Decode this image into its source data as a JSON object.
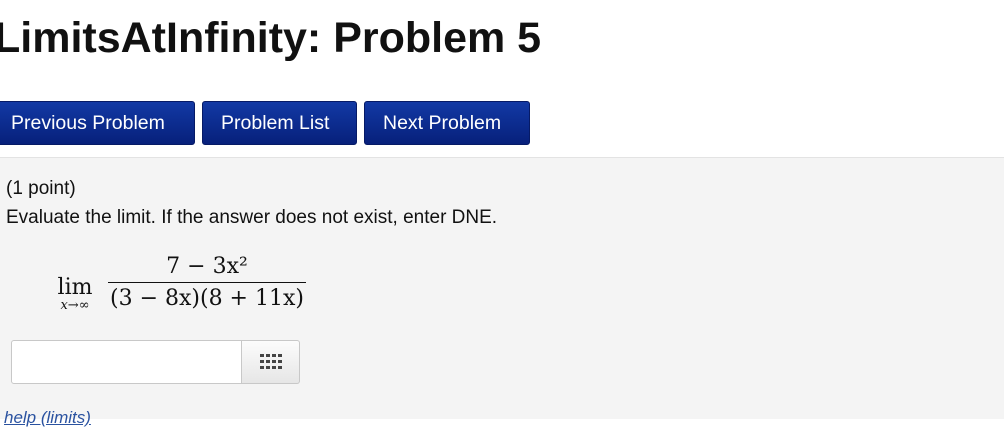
{
  "page": {
    "title": "LimitsAtInfinity: Problem 5"
  },
  "nav": {
    "previous_label": "Previous Problem",
    "list_label": "Problem List",
    "next_label": "Next Problem"
  },
  "problem": {
    "points": "(1 point)",
    "prompt": "Evaluate the limit. If the answer does not exist, enter DNE.",
    "math": {
      "lim": "lim",
      "subscript": "x→∞",
      "numerator": "7 − 3x²",
      "denominator": "(3 − 8x)(8 + 11x)"
    },
    "answer": {
      "value": "",
      "placeholder": ""
    },
    "keyboard_icon": "keypad-grid-icon",
    "help_link": "help (limits)"
  }
}
